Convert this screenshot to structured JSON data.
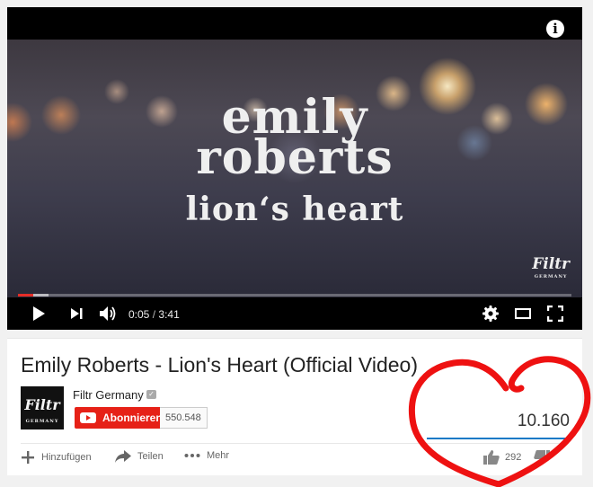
{
  "player": {
    "video_text": {
      "line1": "emily",
      "line2": "roberts",
      "line3": "lion‘s heart"
    },
    "watermark": {
      "main": "Filtr",
      "sub": "GERMANY"
    },
    "info_icon": "info-icon",
    "current_time": "0:05",
    "time_separator": "/",
    "duration": "3:41",
    "progress": {
      "played_fraction": 0.027,
      "buffered_fraction": 0.055,
      "played_color": "#e52d27"
    },
    "controls": [
      "play-icon",
      "next-icon",
      "volume-icon",
      "settings-icon",
      "theater-mode-icon",
      "fullscreen-icon"
    ]
  },
  "video": {
    "title": "Emily Roberts - Lion's Heart (Official Video)",
    "views": "10.160",
    "likes": "292",
    "like_ratio": 0.97
  },
  "channel": {
    "name": "Filtr Germany",
    "thumb_main": "Filtr",
    "thumb_sub": "GERMANY",
    "subscribe_label": "Abonnieren",
    "subscriber_count": "550.548"
  },
  "actions": {
    "add_label": "Hinzufügen",
    "share_label": "Teilen",
    "more_label": "Mehr"
  },
  "colors": {
    "brand_red": "#e62117",
    "annotation_red": "#ee1111",
    "like_blue": "#167ac6"
  }
}
